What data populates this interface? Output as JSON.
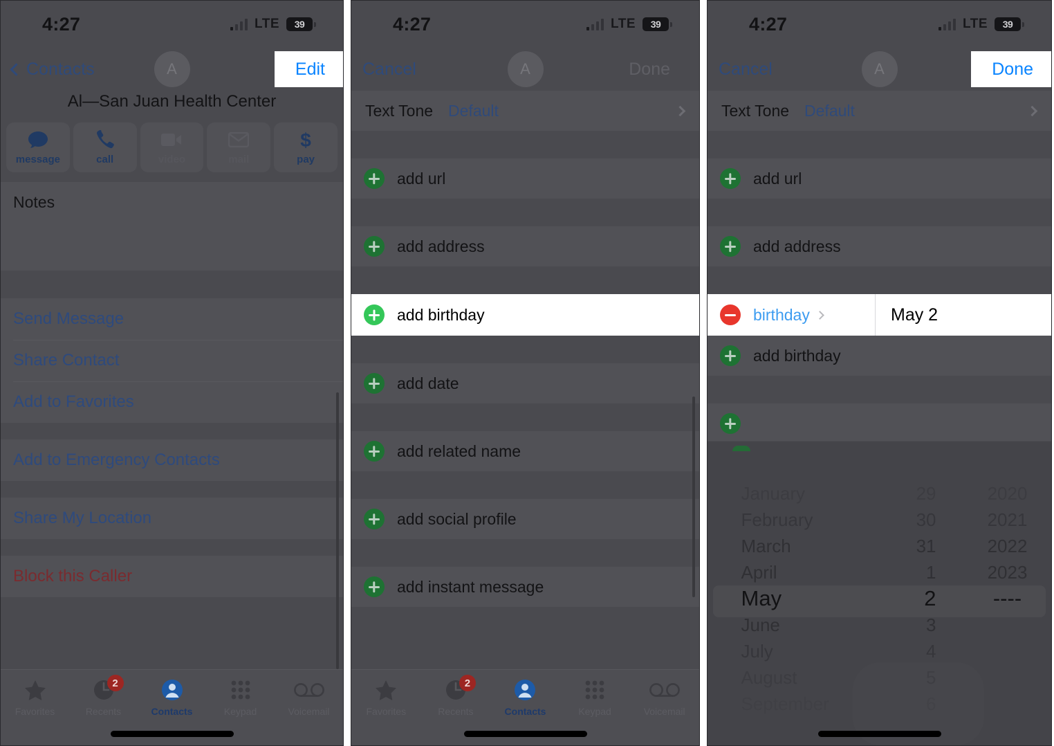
{
  "status_bar": {
    "time": "4:27",
    "network": "LTE",
    "battery": "39"
  },
  "panel1": {
    "nav": {
      "back_label": "Contacts",
      "avatar_initial": "A",
      "action_label": "Edit"
    },
    "contact_name": "Al—San Juan Health Center",
    "quick_actions": [
      {
        "label": "message",
        "icon": "message-bubble-icon",
        "enabled": true
      },
      {
        "label": "call",
        "icon": "phone-handset-icon",
        "enabled": true
      },
      {
        "label": "video",
        "icon": "video-camera-icon",
        "enabled": false
      },
      {
        "label": "mail",
        "icon": "envelope-icon",
        "enabled": false
      },
      {
        "label": "pay",
        "icon": "dollar-sign-icon",
        "enabled": true
      }
    ],
    "notes_label": "Notes",
    "link_group_1": [
      "Send Message",
      "Share Contact",
      "Add to Favorites"
    ],
    "link_group_2": [
      "Add to Emergency Contacts"
    ],
    "link_group_3": [
      "Share My Location"
    ],
    "link_group_4": [
      "Block this Caller"
    ]
  },
  "panel2": {
    "nav": {
      "cancel_label": "Cancel",
      "avatar_initial": "A",
      "done_label": "Done"
    },
    "text_tone": {
      "label": "Text Tone",
      "value": "Default"
    },
    "rows": [
      {
        "label": "add url",
        "highlighted": false
      },
      {
        "label": "add address",
        "highlighted": false
      },
      {
        "label": "add birthday",
        "highlighted": true
      },
      {
        "label": "add date",
        "highlighted": false
      },
      {
        "label": "add related name",
        "highlighted": false
      },
      {
        "label": "add social profile",
        "highlighted": false
      },
      {
        "label": "add instant message",
        "highlighted": false
      }
    ]
  },
  "panel3": {
    "nav": {
      "cancel_label": "Cancel",
      "avatar_initial": "A",
      "done_label": "Done"
    },
    "text_tone": {
      "label": "Text Tone",
      "value": "Default"
    },
    "rows": [
      {
        "label": "add url"
      },
      {
        "label": "add address"
      }
    ],
    "birthday_row": {
      "field_label": "birthday",
      "value": "May 2"
    },
    "add_birthday_label": "add birthday",
    "picker": {
      "months": [
        "January",
        "February",
        "March",
        "April",
        "May",
        "June",
        "July",
        "August",
        "September"
      ],
      "days": [
        "29",
        "30",
        "31",
        "1",
        "2",
        "3",
        "4",
        "5",
        "6"
      ],
      "years": [
        "2020",
        "2021",
        "2022",
        "2023",
        "----"
      ],
      "selected_month": "May",
      "selected_day": "2",
      "selected_year": "----"
    }
  },
  "tab_bar": {
    "items": [
      {
        "label": "Favorites",
        "icon": "star-icon",
        "active": false,
        "badge": ""
      },
      {
        "label": "Recents",
        "icon": "clock-icon",
        "active": false,
        "badge": "2"
      },
      {
        "label": "Contacts",
        "icon": "person-circle-icon",
        "active": true,
        "badge": ""
      },
      {
        "label": "Keypad",
        "icon": "keypad-grid-icon",
        "active": false,
        "badge": ""
      },
      {
        "label": "Voicemail",
        "icon": "voicemail-icon",
        "active": false,
        "badge": ""
      }
    ]
  },
  "colors": {
    "background": "#4a4a4f",
    "card": "#515156",
    "link_blue": "#2f4a7a",
    "highlight_blue": "#0a84ff",
    "add_green": "#34c759",
    "remove_red": "#e8362c",
    "danger_red": "#7a2b2f",
    "badge_red": "#9d2622"
  }
}
